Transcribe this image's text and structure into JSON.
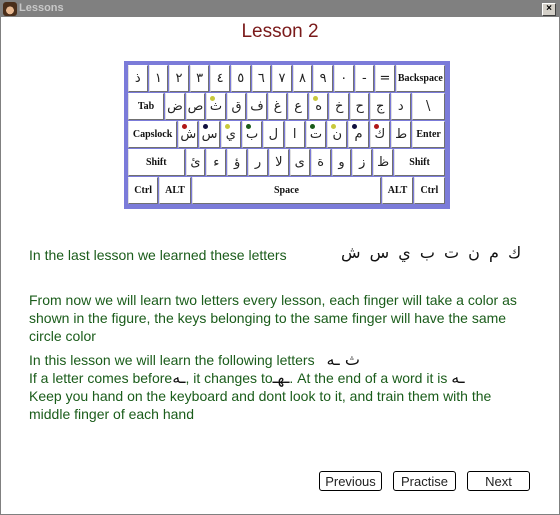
{
  "window": {
    "title": "Lessons",
    "close_label": "×"
  },
  "lesson_title": "Lesson 2",
  "keyboard": {
    "rows": [
      [
        {
          "k": "ذ"
        },
        {
          "k": "١"
        },
        {
          "k": "٢"
        },
        {
          "k": "٣"
        },
        {
          "k": "٤"
        },
        {
          "k": "٥"
        },
        {
          "k": "٦"
        },
        {
          "k": "٧"
        },
        {
          "k": "٨"
        },
        {
          "k": "٩"
        },
        {
          "k": "٠"
        },
        {
          "k": "-"
        },
        {
          "k": "="
        },
        {
          "k": "Backspace",
          "lbl": true
        }
      ],
      [
        {
          "k": "Tab",
          "lbl": true
        },
        {
          "k": "ض"
        },
        {
          "k": "ص"
        },
        {
          "k": "ث",
          "dot": "#c8c83c"
        },
        {
          "k": "ق"
        },
        {
          "k": "ف"
        },
        {
          "k": "غ"
        },
        {
          "k": "ع"
        },
        {
          "k": "ه",
          "dot": "#c8c83c"
        },
        {
          "k": "خ"
        },
        {
          "k": "ح"
        },
        {
          "k": "ج"
        },
        {
          "k": "د"
        },
        {
          "k": "\\"
        }
      ],
      [
        {
          "k": "Capslock",
          "lbl": true
        },
        {
          "k": "ش",
          "dot": "#b01818"
        },
        {
          "k": "س",
          "dot": "#101040"
        },
        {
          "k": "ي",
          "dot": "#c8c83c"
        },
        {
          "k": "ب",
          "dot": "#1a5c1a"
        },
        {
          "k": "ل"
        },
        {
          "k": "ا"
        },
        {
          "k": "ت",
          "dot": "#1a5c1a"
        },
        {
          "k": "ن",
          "dot": "#c8c83c"
        },
        {
          "k": "م",
          "dot": "#101040"
        },
        {
          "k": "ك",
          "dot": "#b01818"
        },
        {
          "k": "ط"
        },
        {
          "k": "Enter",
          "lbl": true
        }
      ],
      [
        {
          "k": "Shift",
          "lbl": true
        },
        {
          "k": "ئ"
        },
        {
          "k": "ء"
        },
        {
          "k": "ؤ"
        },
        {
          "k": "ر"
        },
        {
          "k": "لا"
        },
        {
          "k": "ى"
        },
        {
          "k": "ة"
        },
        {
          "k": "و"
        },
        {
          "k": "ز"
        },
        {
          "k": "ظ"
        },
        {
          "k": "Shift",
          "lbl": true
        }
      ],
      [
        {
          "k": "Ctrl",
          "lbl": true
        },
        {
          "k": "ALT",
          "lbl": true
        },
        {
          "k": "Space",
          "lbl": true
        },
        {
          "k": "ALT",
          "lbl": true
        },
        {
          "k": "Ctrl",
          "lbl": true
        }
      ]
    ]
  },
  "content": {
    "learned_prefix": "In the last lesson we learned these letters",
    "learned_letters": "ك  م  ن  ت  ب  ي س ش",
    "para1": "From now we will learn two letters every lesson, each finger will take a color as shown in the figure, the keys belonging to the same finger will have the same circle color",
    "new_prefix": "In this lesson we will learn the following letters",
    "new_letters": "ث   ـه",
    "change_a": "If a letter comes before",
    "change_glyph1": "ـه",
    "change_b": ", it changes to",
    "change_glyph2": "ـهـ",
    "change_c": ". At the end of a word it is",
    "change_glyph3": "ـه",
    "para3": "Keep you hand on the keyboard and dont look to it, and train them with the middle finger of each hand"
  },
  "buttons": {
    "previous": "Previous",
    "practise": "Practise",
    "next": "Next"
  }
}
